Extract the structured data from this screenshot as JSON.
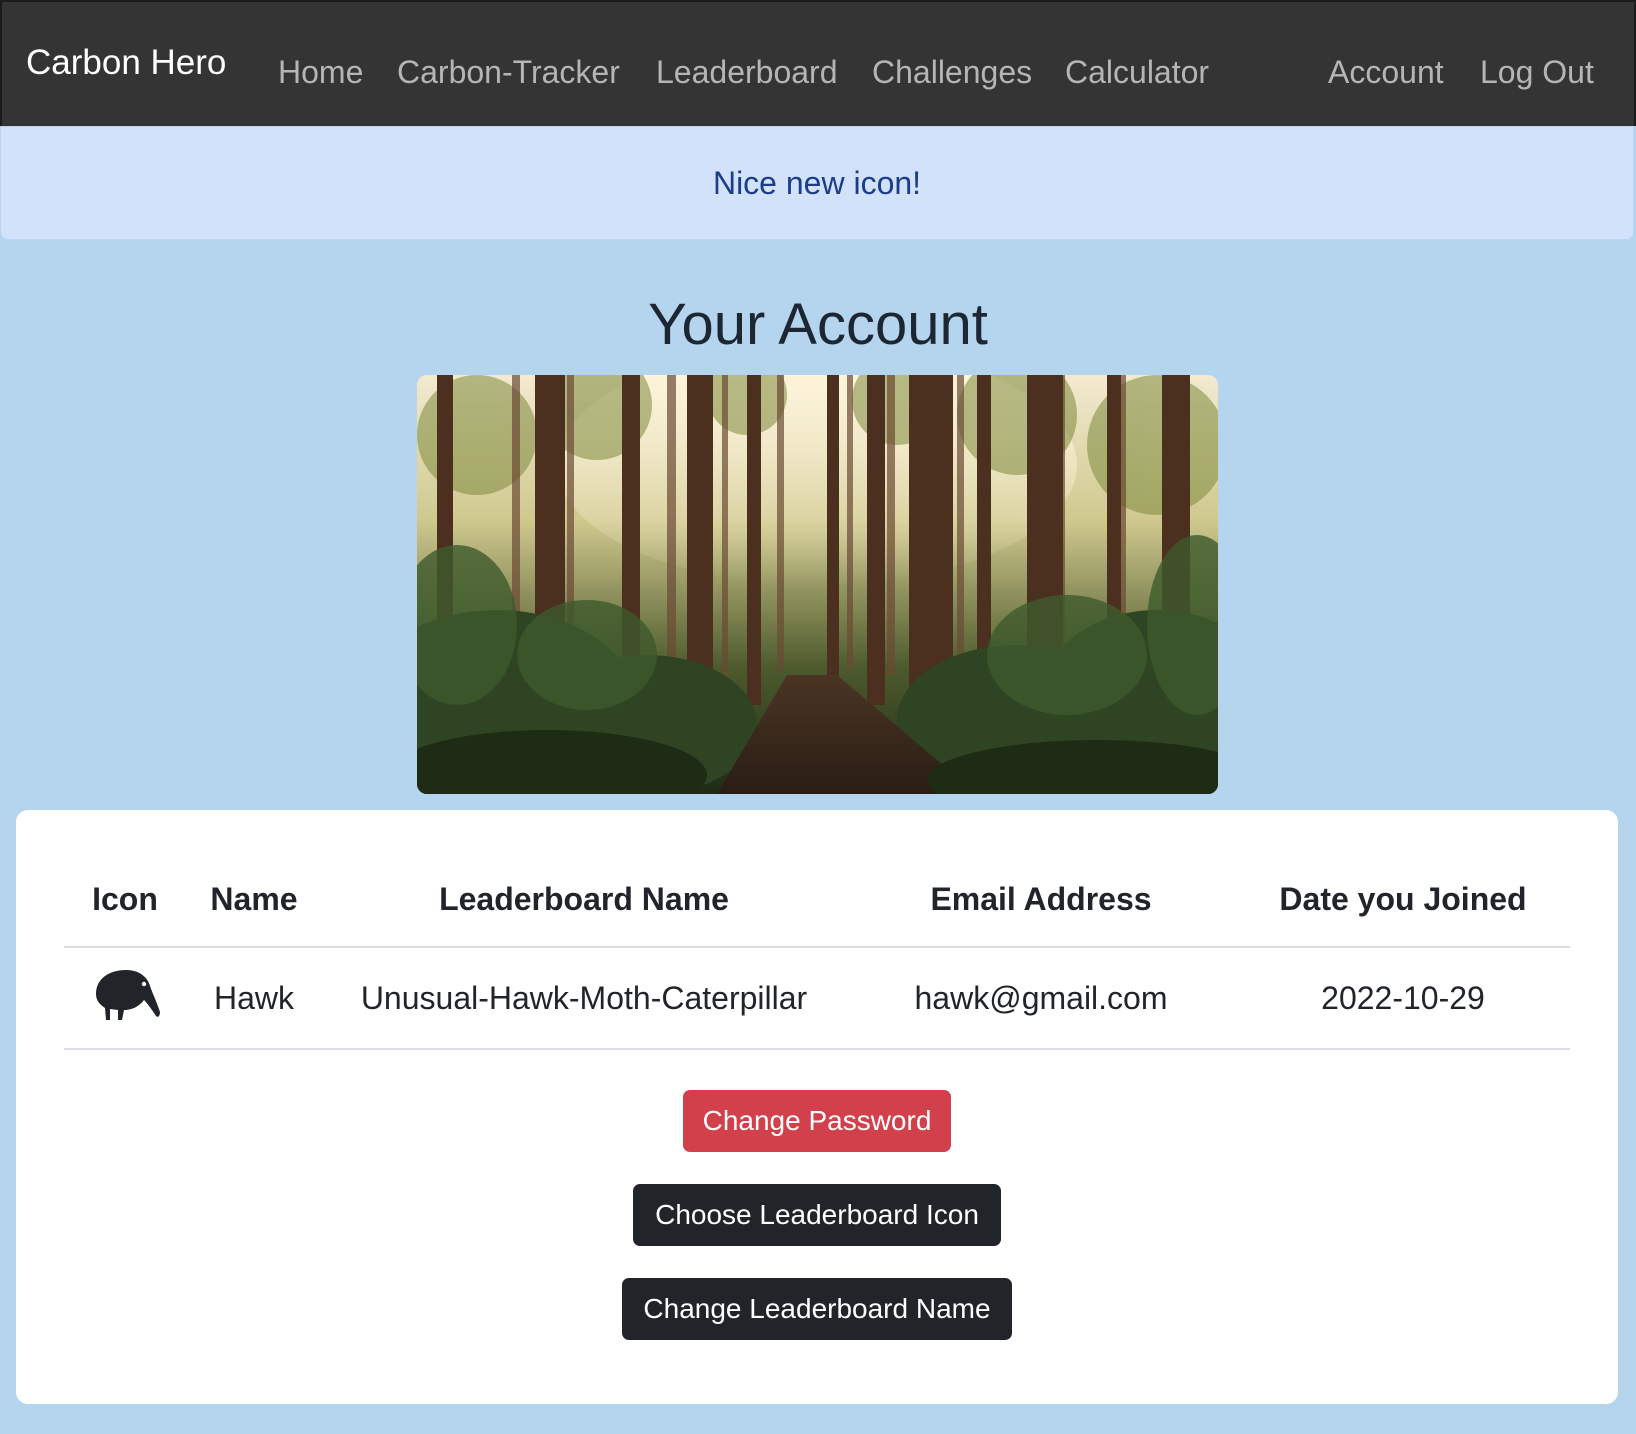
{
  "navbar": {
    "brand": "Carbon Hero",
    "links": [
      "Home",
      "Carbon-Tracker",
      "Leaderboard",
      "Challenges",
      "Calculator"
    ],
    "right_links": [
      "Account",
      "Log Out"
    ]
  },
  "alert": {
    "message": "Nice new icon!"
  },
  "page": {
    "title": "Your Account",
    "hero_image": "forest-path-photo"
  },
  "account_table": {
    "headers": [
      "Icon",
      "Name",
      "Leaderboard Name",
      "Email Address",
      "Date you Joined"
    ],
    "row": {
      "icon": "kiwi-bird-icon",
      "name": "Hawk",
      "leaderboard_name": "Unusual-Hawk-Moth-Caterpillar",
      "email": "hawk@gmail.com",
      "date_joined": "2022-10-29"
    }
  },
  "actions": {
    "change_password": "Change Password",
    "choose_icon": "Choose Leaderboard Icon",
    "change_name": "Change Leaderboard Name"
  },
  "colors": {
    "navbar_bg": "#343434",
    "page_bg": "#b5d5ee",
    "alert_bg": "#d2e2fb",
    "alert_text": "#1b3d8a",
    "danger": "#d1404b",
    "dark": "#212529"
  }
}
